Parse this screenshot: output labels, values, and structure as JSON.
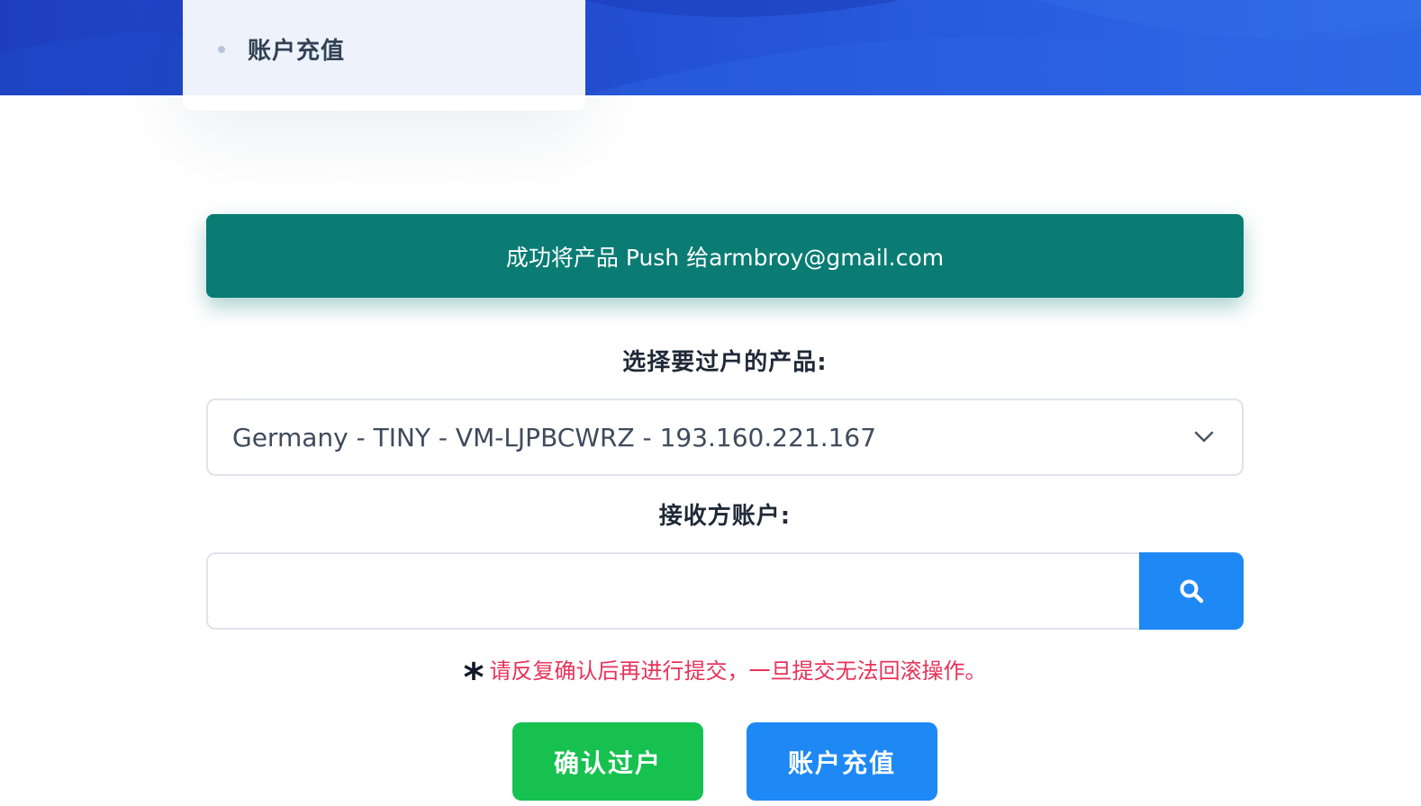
{
  "sidebar_menu": {
    "items": [
      {
        "label": "账户充值"
      }
    ]
  },
  "alert": {
    "message": "成功将产品 Push 给armbroy@gmail.com",
    "color": "#0a7c74"
  },
  "form": {
    "product_label": "选择要过户的产品:",
    "product_selected": "Germany - TINY - VM-LJPBCWRZ - 193.160.221.167",
    "recipient_label": "接收方账户:",
    "recipient_value": "",
    "recipient_placeholder": "",
    "warning_mark": "*",
    "warning_text": "请反复确认后再进行提交，一旦提交无法回滚操作。"
  },
  "actions": {
    "confirm_label": "确认过户",
    "recharge_label": "账户充值"
  },
  "icons": {
    "search": "search-icon",
    "chevron": "chevron-down-icon",
    "bullet": "bullet-dot-icon"
  },
  "colors": {
    "header_blue": "#2350d2",
    "primary_blue": "#1e88f5",
    "success_green": "#16c150",
    "warning_red": "#e8325a"
  }
}
